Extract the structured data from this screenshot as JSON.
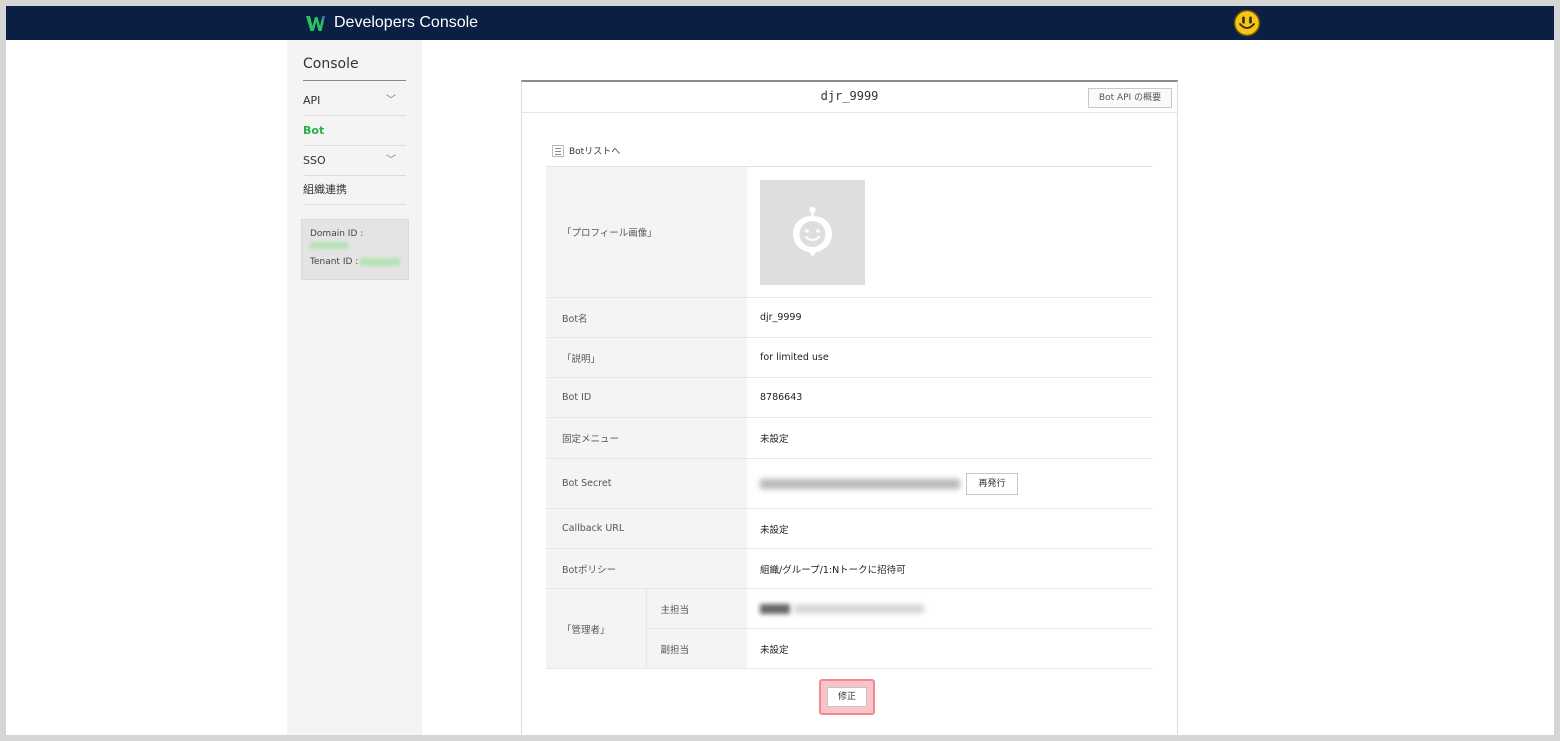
{
  "app": {
    "title": "Developers Console",
    "logo_icon": "works-logo-icon",
    "user_avatar_icon": "smiley-avatar-icon",
    "topbar_color": "#0b1f45"
  },
  "sidebar": {
    "title": "Console",
    "items": [
      {
        "label": "API",
        "has_submenu": true,
        "active": false
      },
      {
        "label": "Bot",
        "has_submenu": false,
        "active": true
      },
      {
        "label": "SSO",
        "has_submenu": true,
        "active": false
      },
      {
        "label": "組織連携",
        "has_submenu": false,
        "active": false
      }
    ],
    "domain_id_label": "Domain ID :",
    "tenant_id_label": "Tenant ID :",
    "active_color": "#25b24a"
  },
  "panel": {
    "title": "djr_9999",
    "api_overview_button": "Bot API の概要",
    "back_link": "Botリストへ",
    "rows": {
      "profile_image_label": "「プロフィール画像」",
      "bot_name_label": "Bot名",
      "bot_name_value": "djr_9999",
      "description_label": "「説明」",
      "description_value": "for limited use",
      "bot_id_label": "Bot ID",
      "bot_id_value": "8786643",
      "fixed_menu_label": "固定メニュー",
      "fixed_menu_value": "未設定",
      "bot_secret_label": "Bot Secret",
      "reissue_button": "再発行",
      "callback_url_label": "Callback URL",
      "callback_url_value": "未設定",
      "bot_policy_label": "Botポリシー",
      "bot_policy_value": "組織/グループ/1:Nトークに招待可",
      "admin_label": "「管理者」",
      "main_admin_label": "主担当",
      "sub_admin_label": "副担当",
      "sub_admin_value": "未設定"
    },
    "edit_button": "修正"
  }
}
